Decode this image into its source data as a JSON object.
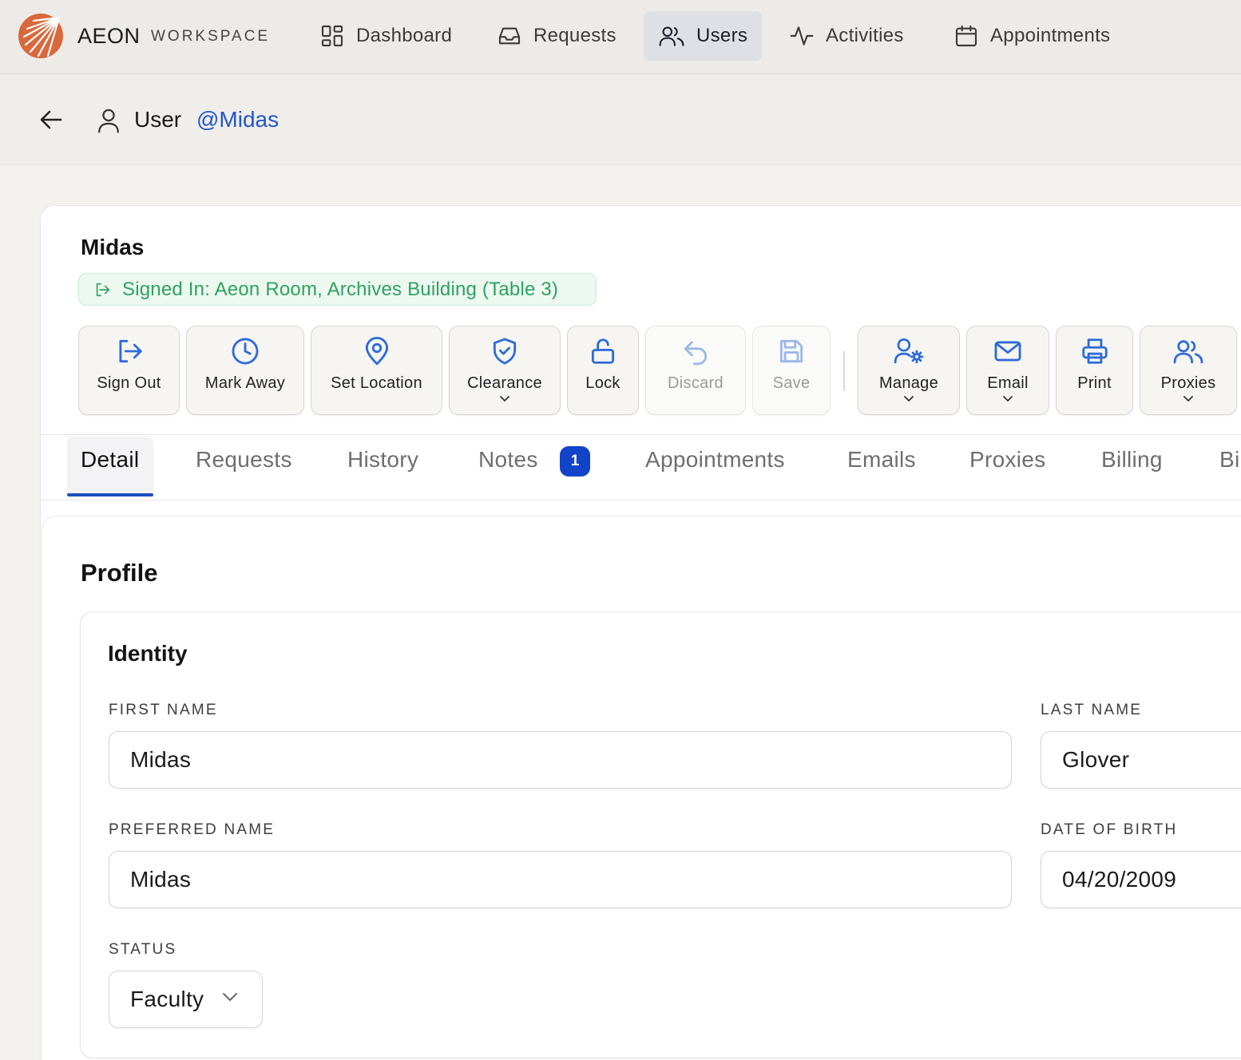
{
  "brand": {
    "name": "AEON",
    "sub": "WORKSPACE"
  },
  "nav": [
    {
      "label": "Dashboard",
      "icon": "dashboard-icon"
    },
    {
      "label": "Requests",
      "icon": "inbox-icon"
    },
    {
      "label": "Users",
      "icon": "users-icon",
      "active": true
    },
    {
      "label": "Activities",
      "icon": "activity-icon"
    },
    {
      "label": "Appointments",
      "icon": "calendar-icon"
    }
  ],
  "header": {
    "label": "User",
    "handle": "@Midas"
  },
  "user": {
    "name": "Midas",
    "signed_in": "Signed In: Aeon Room, Archives Building (Table 3)"
  },
  "actions": {
    "sign_out": "Sign Out",
    "mark_away": "Mark Away",
    "set_location": "Set Location",
    "clearance": "Clearance",
    "lock": "Lock",
    "discard": "Discard",
    "save": "Save",
    "manage": "Manage",
    "email": "Email",
    "print": "Print",
    "proxies": "Proxies"
  },
  "tabs": {
    "detail": "Detail",
    "requests": "Requests",
    "history": "History",
    "notes": "Notes",
    "notes_count": "1",
    "appointments": "Appointments",
    "emails": "Emails",
    "proxies": "Proxies",
    "billing": "Billing",
    "truncated": "Bi"
  },
  "profile": {
    "title": "Profile",
    "identity_title": "Identity",
    "first_name_label": "FIRST NAME",
    "first_name": "Midas",
    "last_name_label": "LAST NAME",
    "last_name": "Glover",
    "preferred_name_label": "PREFERRED NAME",
    "preferred_name": "Midas",
    "dob_label": "DATE OF BIRTH",
    "dob": "04/20/2009",
    "status_label": "STATUS",
    "status": "Faculty"
  },
  "colors": {
    "accent": "#1e4fc0",
    "link": "#2156c9",
    "success": "#2ea262",
    "logo": "#d9683c"
  }
}
